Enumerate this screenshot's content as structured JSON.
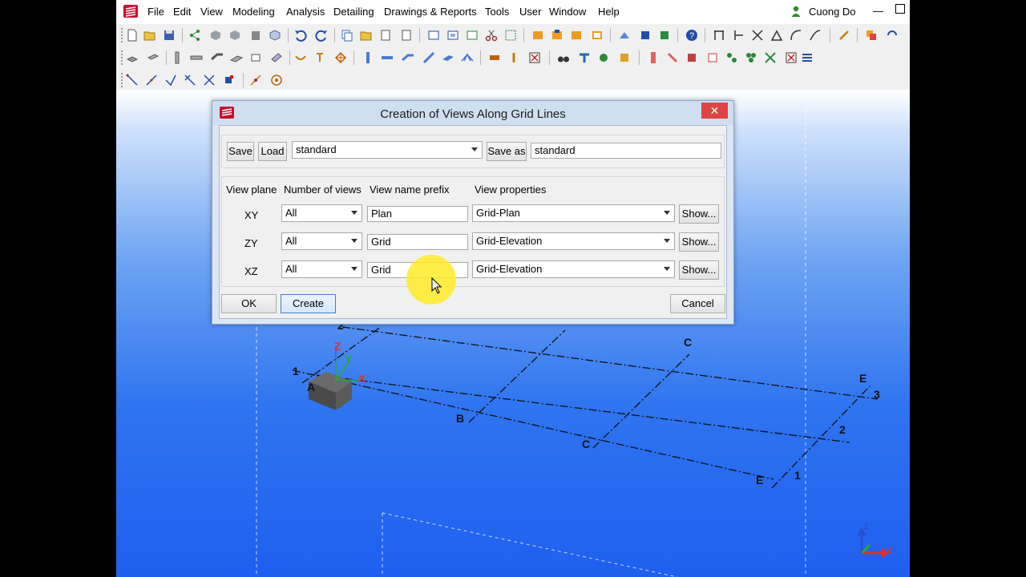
{
  "menubar": {
    "items": [
      "File",
      "Edit",
      "View",
      "Modeling",
      "Analysis",
      "Detailing",
      "Drawings & Reports",
      "Tools",
      "User",
      "Window",
      "Help"
    ],
    "user": "Cuong Do",
    "icons": {
      "logo": "tekla-logo-icon",
      "user": "user-icon"
    }
  },
  "colors": {
    "accent": "#3c7fd1",
    "close": "#e04343",
    "halo": "#ffeb28",
    "viewport_bottom": "#1f5ff0"
  },
  "viewport": {
    "grid_labels": [
      "Z",
      "Y",
      "X",
      "1",
      "A",
      "2",
      "B",
      "C",
      "C",
      "E",
      "E",
      "3",
      "2",
      "1"
    ],
    "axis_labels": [
      "Z",
      "X"
    ]
  },
  "dialog": {
    "title": "Creation of Views Along Grid Lines",
    "close_icon": "close-icon",
    "save_label": "Save",
    "load_label": "Load",
    "settings_value": "standard",
    "save_as_label": "Save as",
    "save_as_value": "standard",
    "columns": {
      "plane": "View plane",
      "count": "Number of views",
      "prefix": "View name prefix",
      "props": "View properties"
    },
    "rows": [
      {
        "plane": "XY",
        "count": "All",
        "prefix": "Plan",
        "props": "Grid-Plan",
        "show": "Show..."
      },
      {
        "plane": "ZY",
        "count": "All",
        "prefix": "Grid",
        "props": "Grid-Elevation",
        "show": "Show..."
      },
      {
        "plane": "XZ",
        "count": "All",
        "prefix": "Grid",
        "props": "Grid-Elevation",
        "show": "Show..."
      }
    ],
    "ok_label": "OK",
    "create_label": "Create",
    "cancel_label": "Cancel"
  }
}
